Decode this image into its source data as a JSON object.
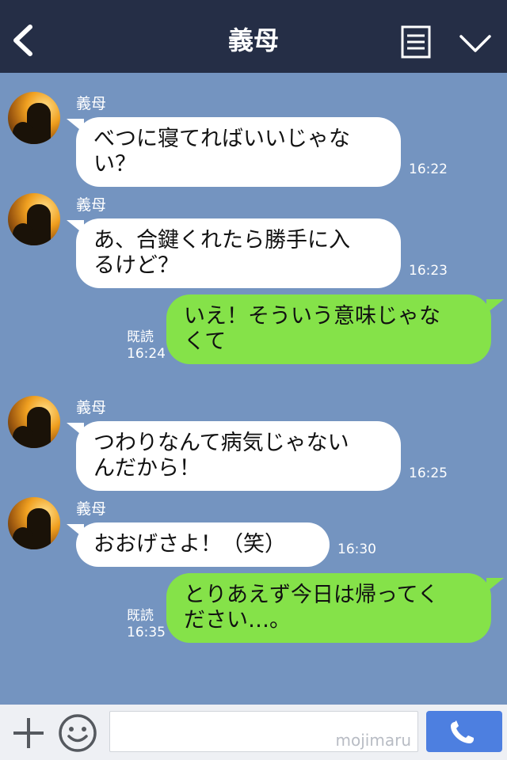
{
  "header": {
    "title": "義母"
  },
  "messages": [
    {
      "type": "incoming",
      "sender": "義母",
      "lines": [
        "べつに寝てればいいじゃな",
        "い？"
      ],
      "time": "16:22"
    },
    {
      "type": "incoming",
      "sender": "義母",
      "lines": [
        "あ、合鍵くれたら勝手に入",
        "るけど？"
      ],
      "time": "16:23"
    },
    {
      "type": "outgoing",
      "lines": [
        "いえ！そういう意味じゃな",
        "くて"
      ],
      "read_label": "既読",
      "time": "16:24"
    },
    {
      "type": "incoming",
      "sender": "義母",
      "lines": [
        "つわりなんて病気じゃない",
        "んだから！"
      ],
      "time": "16:25"
    },
    {
      "type": "incoming",
      "sender": "義母",
      "lines": [
        "おおげさよ！（笑）"
      ],
      "time": "16:30"
    },
    {
      "type": "outgoing",
      "lines": [
        "とりあえず今日は帰ってく",
        "ださい…。"
      ],
      "read_label": "既読",
      "time": "16:35"
    }
  ],
  "footer": {
    "input_value": "",
    "watermark": "mojimaru"
  },
  "icons": {
    "back": "chevron-left-icon",
    "menu": "menu-document-icon",
    "down": "chevron-down-icon",
    "plus": "plus-icon",
    "emoji": "smiley-icon",
    "call": "phone-icon"
  },
  "colors": {
    "header_bg": "#252e46",
    "chat_bg": "#7494c0",
    "incoming_bubble": "#ffffff",
    "outgoing_bubble": "#85e249",
    "call_button": "#4d7fe0"
  }
}
